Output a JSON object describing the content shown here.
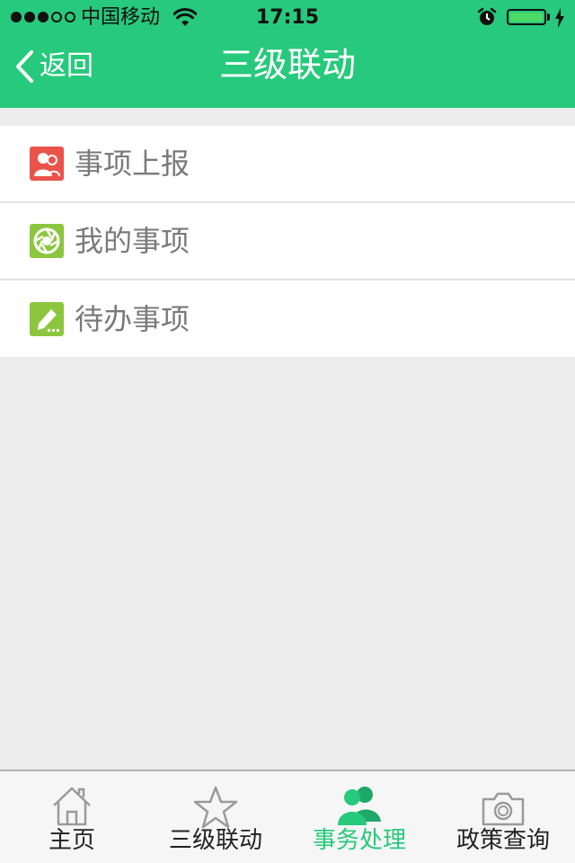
{
  "status_bar": {
    "carrier": "中国移动",
    "time": "17:15"
  },
  "nav": {
    "back_label": "返回",
    "title": "三级联动"
  },
  "menu": {
    "items": [
      {
        "label": "事项上报",
        "icon": "report-user-icon",
        "color": "#e9534a"
      },
      {
        "label": "我的事项",
        "icon": "aperture-icon",
        "color": "#8cc63f"
      },
      {
        "label": "待办事项",
        "icon": "edit-pencil-icon",
        "color": "#8cc63f"
      }
    ]
  },
  "tab_bar": {
    "active_index": 2,
    "tabs": [
      {
        "label": "主页",
        "icon": "home-icon"
      },
      {
        "label": "三级联动",
        "icon": "star-icon"
      },
      {
        "label": "事务处理",
        "icon": "users-icon"
      },
      {
        "label": "政策查询",
        "icon": "camera-icon"
      }
    ]
  },
  "colors": {
    "brand_green": "#27c97c",
    "background": "#ededed",
    "menu_text": "#7a7a7a",
    "battery": "#4cd964"
  }
}
